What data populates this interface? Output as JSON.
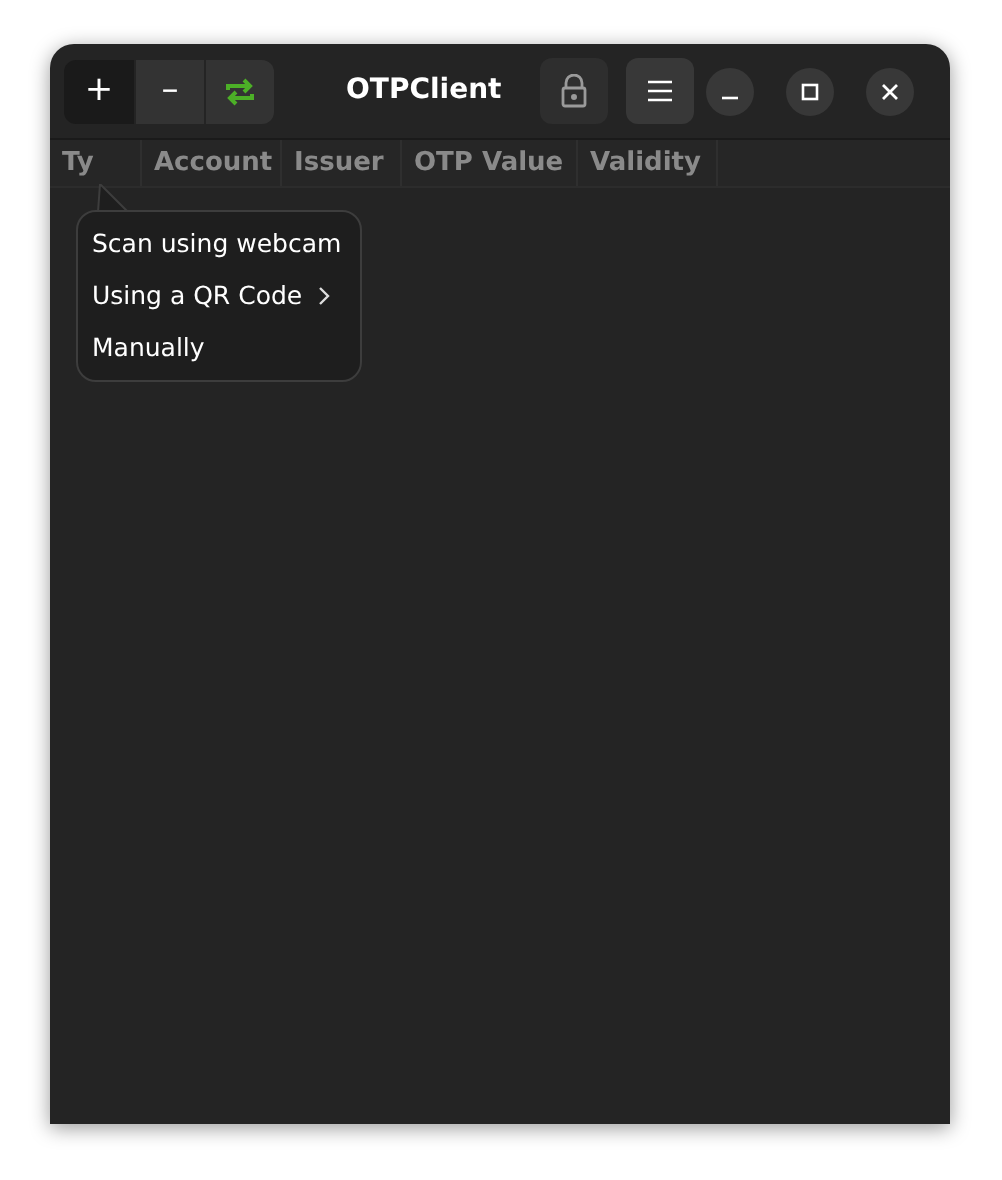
{
  "window": {
    "title": "OTPClient"
  },
  "toolbar": [
    {
      "kind": "add",
      "label": "+",
      "selected": true
    },
    {
      "kind": "remove",
      "label": "–",
      "selected": false
    },
    {
      "kind": "refresh",
      "selected": false
    }
  ],
  "table": {
    "columns": [
      "Ty",
      "Account",
      "Issuer",
      "OTP Value",
      "Validity"
    ]
  },
  "popover": {
    "items": [
      {
        "label": "Scan using webcam",
        "submenu": false
      },
      {
        "label": "Using a QR Code",
        "submenu": true
      },
      {
        "label": "Manually",
        "submenu": false
      }
    ]
  }
}
